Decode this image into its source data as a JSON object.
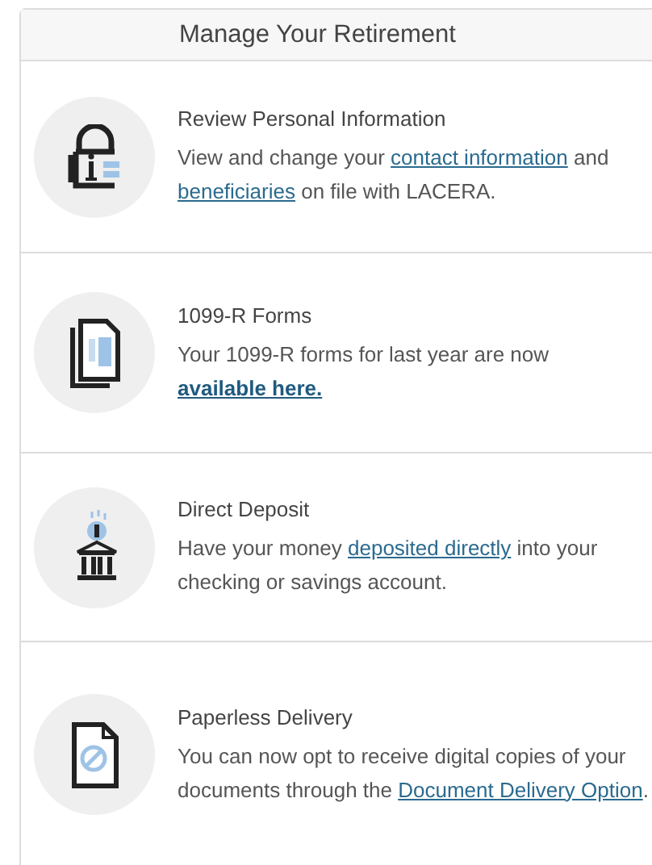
{
  "panel": {
    "title": "Manage Your Retirement"
  },
  "items": [
    {
      "title": "Review Personal Information",
      "description": [
        {
          "kind": "text",
          "text": "View and change your "
        },
        {
          "kind": "link",
          "text": "contact information"
        },
        {
          "kind": "text",
          "text": " and "
        },
        {
          "kind": "link",
          "text": "beneficiaries"
        },
        {
          "kind": "text",
          "text": " on file with LACERA."
        }
      ]
    },
    {
      "title": "1099-R Forms",
      "description": [
        {
          "kind": "text",
          "text": "Your 1099-R forms for last year are now "
        },
        {
          "kind": "bold_link",
          "text": "available here."
        }
      ]
    },
    {
      "title": "Direct Deposit",
      "description": [
        {
          "kind": "text",
          "text": "Have your money "
        },
        {
          "kind": "link",
          "text": "deposited directly"
        },
        {
          "kind": "text",
          "text": " into your checking or savings account."
        }
      ]
    },
    {
      "title": "Paperless Delivery",
      "description": [
        {
          "kind": "text",
          "text": "You can now opt to receive digital copies of your documents through the "
        },
        {
          "kind": "link",
          "text": "Document Delivery Option"
        },
        {
          "kind": "text",
          "text": "."
        }
      ]
    }
  ]
}
